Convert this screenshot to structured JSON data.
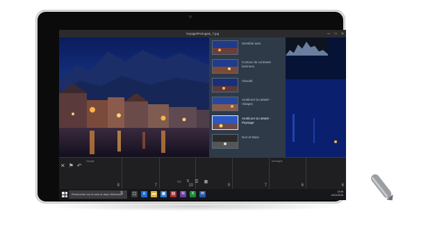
{
  "window": {
    "title": "Voyage/Portugais_7.jpg"
  },
  "win_controls": [
    "—",
    "□",
    "✕"
  ],
  "edit_panel": {
    "filters": [
      {
        "label": "Sensible auto",
        "selected": false
      },
      {
        "label": "Contour de contraste lumineux",
        "selected": false
      },
      {
        "label": "Vivacité",
        "selected": false
      },
      {
        "label": "Améliorer la netteté - Visages",
        "selected": false
      },
      {
        "label": "Améliorer la netteté - Paysage",
        "selected": true
      },
      {
        "label": "Noir et blanc",
        "selected": false
      }
    ]
  },
  "filmstrip": {
    "cells": [
      {
        "name": "Voyage",
        "count": "8"
      },
      {
        "name": "",
        "count": "7"
      },
      {
        "name": "",
        "count": "10"
      },
      {
        "name": "",
        "count": "9"
      },
      {
        "name": "",
        "count": "7"
      },
      {
        "name": "Montagne",
        "count": "6"
      },
      {
        "name": "",
        "count": "6"
      }
    ]
  },
  "taskbar": {
    "search_placeholder": "Rechercher sur le web et dans Windows",
    "tray_time": "13:45",
    "tray_date": "12/01/2015"
  },
  "colors": {
    "panel": "#2e3a48",
    "night_sky": "#0d2a73",
    "accent_lights": "#f2a93b"
  },
  "icons": [
    "close-icon",
    "flag-icon",
    "undo-icon",
    "search-icon",
    "microphone-icon",
    "task-view-icon",
    "edge-icon",
    "folder-icon",
    "store-icon",
    "mail-icon"
  ]
}
